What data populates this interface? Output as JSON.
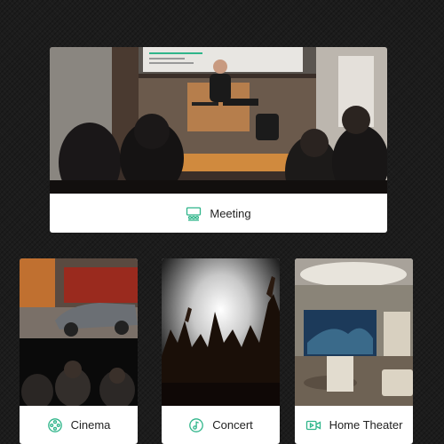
{
  "accent_color": "#2fb58a",
  "cards": [
    {
      "label": "Meeting",
      "icon": "classroom-icon"
    },
    {
      "label": "Cinema",
      "icon": "film-reel-icon"
    },
    {
      "label": "Concert",
      "icon": "music-note-icon"
    },
    {
      "label": "Home Theater",
      "icon": "video-camera-icon"
    }
  ]
}
